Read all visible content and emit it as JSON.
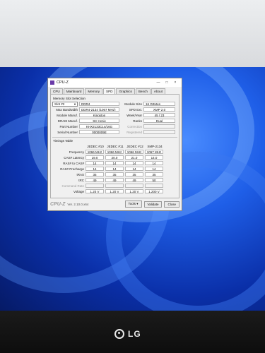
{
  "window": {
    "title": "CPU-Z",
    "controls": {
      "minimize": "—",
      "maximize": "□",
      "close": "×"
    }
  },
  "tabs": [
    {
      "label": "CPU"
    },
    {
      "label": "Mainboard"
    },
    {
      "label": "Memory"
    },
    {
      "label": "SPD",
      "active": true
    },
    {
      "label": "Graphics"
    },
    {
      "label": "Bench"
    },
    {
      "label": "About"
    }
  ],
  "slot_section": {
    "title": "Memory Slot Selection",
    "selected_slot": "Slot #2",
    "type": "DDR4",
    "module_size_label": "Module Size",
    "module_size": "16 GBytes",
    "max_bandwidth_label": "Max Bandwidth",
    "max_bandwidth": "DDR4-2134 (1067 MHz)",
    "spd_ext_label": "SPD Ext.",
    "spd_ext": "XMP 2.0",
    "module_manuf_label": "Module Manuf.",
    "module_manuf": "Kingston",
    "week_year_label": "Week/Year",
    "week_year": "45 / 23",
    "dram_manuf_label": "DRAM Manuf.",
    "dram_manuf": "SK Hynix",
    "ranks_label": "Ranks",
    "ranks": "Dual",
    "part_number_label": "Part Number",
    "part_number": "KHX2133C14/16G",
    "correction_label": "Correction",
    "correction": "",
    "serial_number_label": "Serial Number",
    "serial_number": "0000009E",
    "registered_label": "Registered",
    "registered": ""
  },
  "timings": {
    "title": "Timings Table",
    "columns": [
      "JEDEC #10",
      "JEDEC #11",
      "JEDEC #12",
      "XMP-2134"
    ],
    "rows": [
      {
        "label": "Frequency",
        "values": [
          "1066 MHz",
          "1066 MHz",
          "1066 MHz",
          "1067 MHz"
        ]
      },
      {
        "label": "CAS# Latency",
        "values": [
          "19.0",
          "20.0",
          "21.0",
          "14.0"
        ]
      },
      {
        "label": "RAS# to CAS#",
        "values": [
          "14",
          "14",
          "14",
          "14"
        ]
      },
      {
        "label": "RAS# Precharge",
        "values": [
          "14",
          "14",
          "14",
          "14"
        ]
      },
      {
        "label": "tRAS",
        "values": [
          "35",
          "35",
          "35",
          "35"
        ]
      },
      {
        "label": "tRC",
        "values": [
          "49",
          "49",
          "49",
          "50"
        ]
      },
      {
        "label": "Command Rate",
        "values": [
          "",
          "",
          "",
          ""
        ]
      },
      {
        "label": "Voltage",
        "values": [
          "1.20 V",
          "1.20 V",
          "1.20 V",
          "1.200 V"
        ]
      }
    ]
  },
  "footer": {
    "brand": "CPU-Z",
    "version": "Ver. 2.10.0.x64",
    "tools": "Tools",
    "tools_arrow": "▾",
    "validate": "Validate",
    "close": "Close"
  },
  "monitor": {
    "brand": "LG"
  }
}
